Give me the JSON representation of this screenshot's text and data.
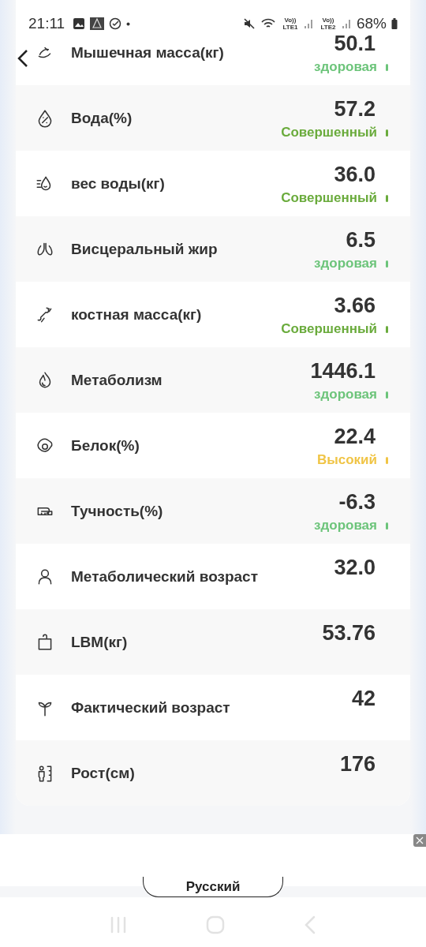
{
  "status_bar": {
    "time": "21:11",
    "battery": "68%",
    "sim_1": "Vo)) LTE1",
    "sim_2": "Vo)) LTE2"
  },
  "metrics": [
    {
      "label": "Мышечная масса(кг)",
      "value": "50.1",
      "status": "здоровая",
      "color": "#6cc47a"
    },
    {
      "label": "Вода(%)",
      "value": "57.2",
      "status": "Совершенный",
      "color": "#6aab3c"
    },
    {
      "label": "вес воды(кг)",
      "value": "36.0",
      "status": "Совершенный",
      "color": "#6aab3c"
    },
    {
      "label": "Висцеральный жир",
      "value": "6.5",
      "status": "здоровая",
      "color": "#6cc47a"
    },
    {
      "label": "костная масса(кг)",
      "value": "3.66",
      "status": "Совершенный",
      "color": "#6aab3c"
    },
    {
      "label": "Метаболизм",
      "value": "1446.1",
      "status": "здоровая",
      "color": "#6cc47a"
    },
    {
      "label": "Белок(%)",
      "value": "22.4",
      "status": "Высокий",
      "color": "#f0c445"
    },
    {
      "label": "Тучность(%)",
      "value": "-6.3",
      "status": "здоровая",
      "color": "#6cc47a"
    },
    {
      "label": "Метаболический возраст",
      "value": "32.0"
    },
    {
      "label": "LBM(кг)",
      "value": "53.76"
    },
    {
      "label": "Фактический возраст",
      "value": "42"
    },
    {
      "label": "Рост(см)",
      "value": "176"
    }
  ],
  "language_button": {
    "label": "Русский"
  }
}
